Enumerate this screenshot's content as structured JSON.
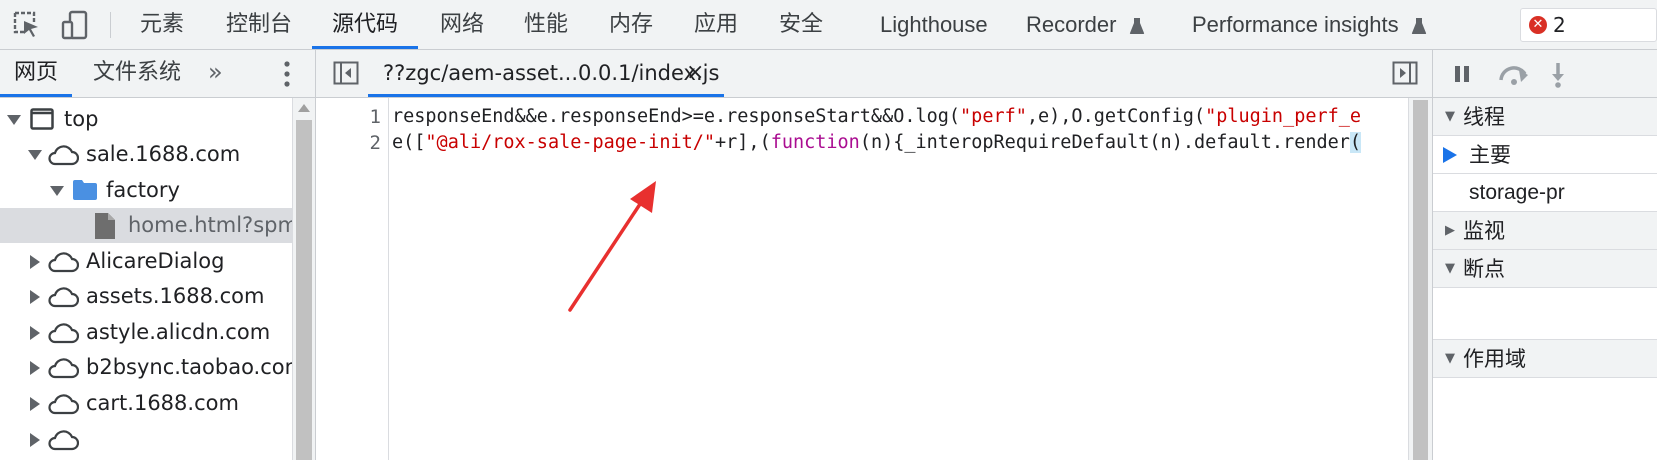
{
  "toolbar": {
    "tabs": [
      {
        "label": "元素"
      },
      {
        "label": "控制台"
      },
      {
        "label": "源代码",
        "active": true
      },
      {
        "label": "网络"
      },
      {
        "label": "性能"
      },
      {
        "label": "内存"
      },
      {
        "label": "应用"
      },
      {
        "label": "安全"
      },
      {
        "label": "Lighthouse"
      },
      {
        "label": "Recorder"
      },
      {
        "label": "Performance insights"
      }
    ],
    "error_count": "2"
  },
  "navigator": {
    "tabs": [
      {
        "label": "网页",
        "active": true
      },
      {
        "label": "文件系统"
      }
    ],
    "more": "»",
    "tree": [
      {
        "label": "top",
        "icon": "frame-icon",
        "expanded": true
      },
      {
        "label": "sale.1688.com",
        "icon": "cloud-icon",
        "expanded": true
      },
      {
        "label": "factory",
        "icon": "folder-icon",
        "expanded": true
      },
      {
        "label": "home.html?spm=",
        "icon": "file-icon",
        "selected": true
      },
      {
        "label": "AlicareDialog",
        "icon": "cloud-icon"
      },
      {
        "label": "assets.1688.com",
        "icon": "cloud-icon"
      },
      {
        "label": "astyle.alicdn.com",
        "icon": "cloud-icon"
      },
      {
        "label": "b2bsync.taobao.com",
        "icon": "cloud-icon"
      },
      {
        "label": "cart.1688.com",
        "icon": "cloud-icon"
      }
    ]
  },
  "editor": {
    "tab_label": "??zgc/aem-asset...0.0.1/index.js",
    "close": "×",
    "lines": [
      {
        "number": "1",
        "segments": [
          {
            "text": "responseEnd&&e.responseEnd>=e.responseStart&&O.log(",
            "class": ""
          },
          {
            "text": "\"perf\"",
            "class": "str"
          },
          {
            "text": ",e),O.getConfig(",
            "class": ""
          },
          {
            "text": "\"plugin_perf_e",
            "class": "str"
          }
        ]
      },
      {
        "number": "2",
        "segments": [
          {
            "text": "e([",
            "class": ""
          },
          {
            "text": "\"@ali/rox-sale-page-init/\"",
            "class": "str"
          },
          {
            "text": "+r],(",
            "class": ""
          },
          {
            "text": "function",
            "class": "kw"
          },
          {
            "text": "(n){_interopRequireDefault(n).default.render",
            "class": ""
          },
          {
            "text": "(",
            "class": "bracket"
          }
        ]
      }
    ]
  },
  "debugger": {
    "sections": {
      "threads": "线程",
      "main_thread": "主要",
      "storage": "storage-pr",
      "watch": "监视",
      "breakpoints": "断点",
      "scope": "作用域"
    }
  },
  "colors": {
    "accent": "#1a73e8",
    "annotation": "#e8302f",
    "folder": "#4a90e2"
  }
}
